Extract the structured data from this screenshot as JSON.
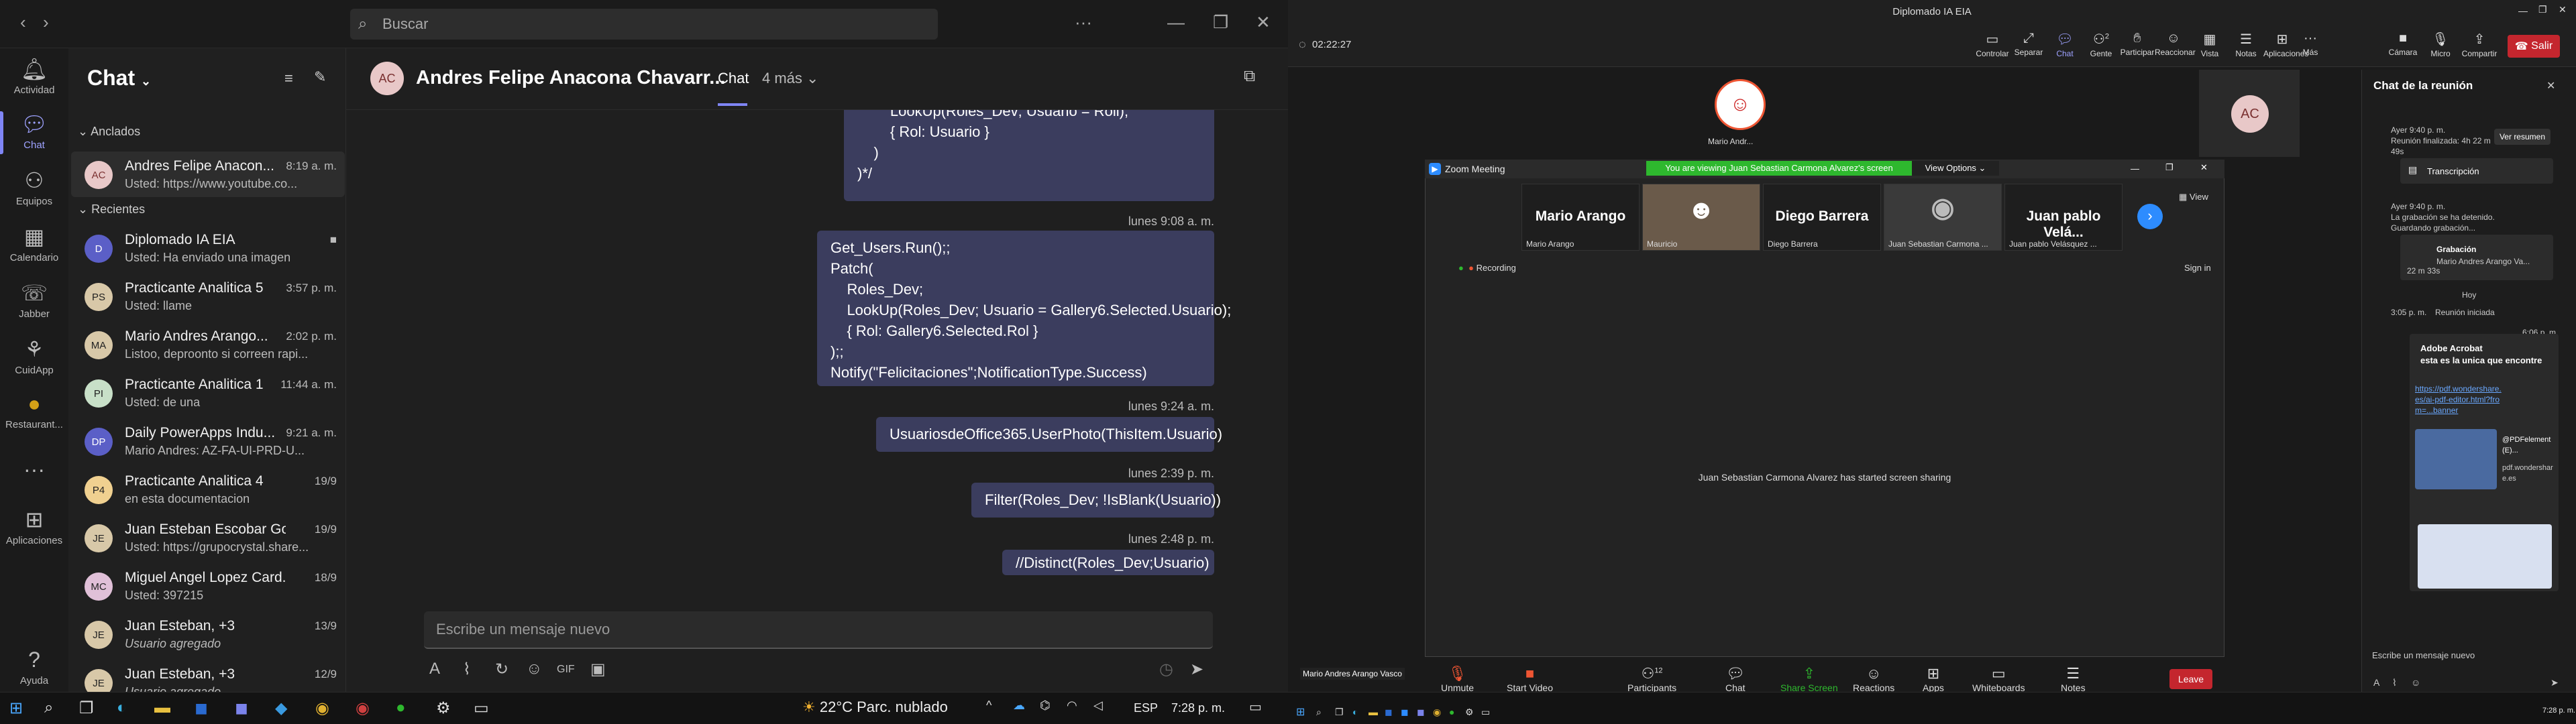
{
  "teams": {
    "search_placeholder": "Buscar",
    "user_initials": "AC",
    "rail": [
      {
        "label": "Actividad",
        "icon": "bell-icon"
      },
      {
        "label": "Chat",
        "icon": "chat-icon"
      },
      {
        "label": "Equipos",
        "icon": "teams-icon"
      },
      {
        "label": "Calendario",
        "icon": "calendar-icon"
      },
      {
        "label": "Jabber",
        "icon": "jabber-icon"
      },
      {
        "label": "CuidApp",
        "icon": "app-icon"
      },
      {
        "label": "Restaurant...",
        "icon": "restaurant-icon"
      },
      {
        "label": "Aplicaciones",
        "icon": "apps-icon"
      },
      {
        "label": "Ayuda",
        "icon": "help-icon"
      }
    ],
    "list_title": "Chat",
    "pinned_label": "Anclados",
    "recent_label": "Recientes",
    "chats": [
      {
        "initials": "AC",
        "name": "Andres Felipe Anacon...",
        "time": "8:19 a. m.",
        "preview": "Usted: https://www.youtube.co..."
      },
      {
        "initials": "D",
        "name": "Diplomado IA EIA",
        "time": "",
        "preview": "Usted: Ha enviado una imagen"
      },
      {
        "initials": "PS",
        "name": "Practicante Analitica 5",
        "time": "3:57 p. m.",
        "preview": "Usted: llame"
      },
      {
        "initials": "MA",
        "name": "Mario Andres Arango...",
        "time": "2:02 p. m.",
        "preview": "Listoo, deproonto si correen rapi..."
      },
      {
        "initials": "PI",
        "name": "Practicante Analitica 1",
        "time": "11:44 a. m.",
        "preview": "Usted: de una"
      },
      {
        "initials": "DP",
        "name": "Daily PowerApps Indu...",
        "time": "9:21 a. m.",
        "preview": "Mario Andres: AZ-FA-UI-PRD-U..."
      },
      {
        "initials": "P4",
        "name": "Practicante Analitica 4",
        "time": "19/9",
        "preview": "en esta documentacion"
      },
      {
        "initials": "JE",
        "name": "Juan Esteban Escobar Go...",
        "time": "19/9",
        "preview": "Usted: https://grupocrystal.share..."
      },
      {
        "initials": "MC",
        "name": "Miguel Angel Lopez Card...",
        "time": "18/9",
        "preview": "Usted: 397215"
      },
      {
        "initials": "JE",
        "name": "Juan Esteban, +3",
        "time": "13/9",
        "preview": "Usuario agregado"
      },
      {
        "initials": "JE",
        "name": "Juan Esteban, +3",
        "time": "12/9",
        "preview": "Usuario agregado"
      }
    ],
    "header": {
      "initials": "AC",
      "name": "Andres Felipe Anacona Chavarr...",
      "tab": "Chat",
      "more": "4 más"
    },
    "messages": [
      {
        "time": "",
        "text": "        LookUp(Roles_Dev; Usuario = Roll);\n        { Rol: Usuario }\n    )\n)*/"
      },
      {
        "time": "lunes 9:08 a. m.",
        "text": "Get_Users.Run();;\nPatch(\n    Roles_Dev;\n    LookUp(Roles_Dev; Usuario = Gallery6.Selected.Usuario);\n    { Rol: Gallery6.Selected.Rol }\n);;\nNotify(\"Felicitaciones\";NotificationType.Success)"
      },
      {
        "time": "lunes 9:24 a. m.",
        "text": "UsuariosdeOffice365.UserPhoto(ThisItem.Usuario)"
      },
      {
        "time": "lunes 2:39 p. m.",
        "text": "Filter(Roles_Dev; !IsBlank(Usuario))"
      },
      {
        "time": "lunes 2:48 p. m.",
        "text": "//Distinct(Roles_Dev;Usuario)"
      }
    ],
    "compose_placeholder": "Escribe un mensaje nuevo"
  },
  "zoom": {
    "window_title": "Diplomado IA EIA",
    "timer": "02:22:27",
    "toolbar": [
      {
        "label": "Controlar",
        "icon": "control-icon"
      },
      {
        "label": "Separar",
        "icon": "separate-icon"
      },
      {
        "label": "Chat",
        "icon": "chat-icon"
      },
      {
        "label": "Gente",
        "icon": "people-icon"
      },
      {
        "label": "Participar",
        "icon": "raise-hand-icon"
      },
      {
        "label": "Reaccionar",
        "icon": "react-icon"
      },
      {
        "label": "Vista",
        "icon": "view-icon"
      },
      {
        "label": "Notas",
        "icon": "notes-icon"
      },
      {
        "label": "Aplicaciones",
        "icon": "apps-icon"
      },
      {
        "label": "Más",
        "icon": "more-icon"
      },
      {
        "label": "Cámara",
        "icon": "camera-icon"
      },
      {
        "label": "Micro",
        "icon": "mic-icon"
      },
      {
        "label": "Compartir",
        "icon": "share-icon"
      }
    ],
    "people_count": "2",
    "leave_label": "Salir",
    "presenter_tile_label": "Mario Andr...",
    "ac_initials": "AC",
    "meeting_window_title": "Zoom Meeting",
    "viewing_banner": "You are viewing Juan Sebastian Carmona Alvarez's screen",
    "view_options": "View Options",
    "view_label": "View",
    "participants": [
      {
        "display": "Mario Arango",
        "sub": "Mario Arango"
      },
      {
        "display": "",
        "sub": "Mauricio"
      },
      {
        "display": "Diego Barrera",
        "sub": "Diego Barrera"
      },
      {
        "display": "",
        "sub": "Juan Sebastian Carmona ..."
      },
      {
        "display": "Juan pablo Velá...",
        "sub": "Juan pablo Velásquez ..."
      }
    ],
    "recording": "Recording",
    "sign_in": "Sign in",
    "share_message": "Juan Sebastian Carmona Alvarez has started screen sharing",
    "bottom_bar": [
      {
        "label": "Unmute",
        "icon": "mic-muted-icon"
      },
      {
        "label": "Start Video",
        "icon": "video-off-icon"
      },
      {
        "label": "Participants",
        "icon": "participants-icon"
      },
      {
        "label": "Chat",
        "icon": "chat-icon"
      },
      {
        "label": "Share Screen",
        "icon": "share-screen-icon"
      },
      {
        "label": "Reactions",
        "icon": "reactions-icon"
      },
      {
        "label": "Apps",
        "icon": "apps-icon"
      },
      {
        "label": "Whiteboards",
        "icon": "whiteboard-icon"
      },
      {
        "label": "Notes",
        "icon": "notes-icon"
      }
    ],
    "participants_count": "12",
    "bottom_leave": "Leave",
    "self_name": "Mario Andres Arango Vasco",
    "chat_panel": {
      "title": "Chat de la reunión",
      "item1_time": "Ayer 9:40 p. m.",
      "item1_text": "Reunión finalizada: 4h 22 m 49s",
      "item1_button": "Ver resumen",
      "transcript": "Transcripción",
      "item2_time": "Ayer 9:40 p. m.",
      "item2_text": "La grabación se ha detenido. Guardando grabación...",
      "recording_title": "Grabación",
      "recording_sub": "Mario Andres Arango Va...",
      "recording_len": "22 m 33s",
      "today": "Hoy",
      "item3_time": "3:05 p. m.",
      "item3_text": "Reunión iniciada",
      "msg_time": "6:06 p. m.",
      "msg_title": "Adobe Acrobat",
      "msg_text": "esta es la unica que encontre",
      "link": "https://pdf.wondershare.es/ai-pdf-editor.html?from=...banner",
      "link_card_title": "@PDFelement (E)...",
      "link_card_sub": "pdf.wondershare.es",
      "input_placeholder": "Escribe un mensaje nuevo"
    }
  },
  "taskbar": {
    "weather": "22°C  Parc. nublado",
    "lang": "ESP",
    "time": "7:28 p. m.",
    "time2": "7:28 p. m."
  }
}
